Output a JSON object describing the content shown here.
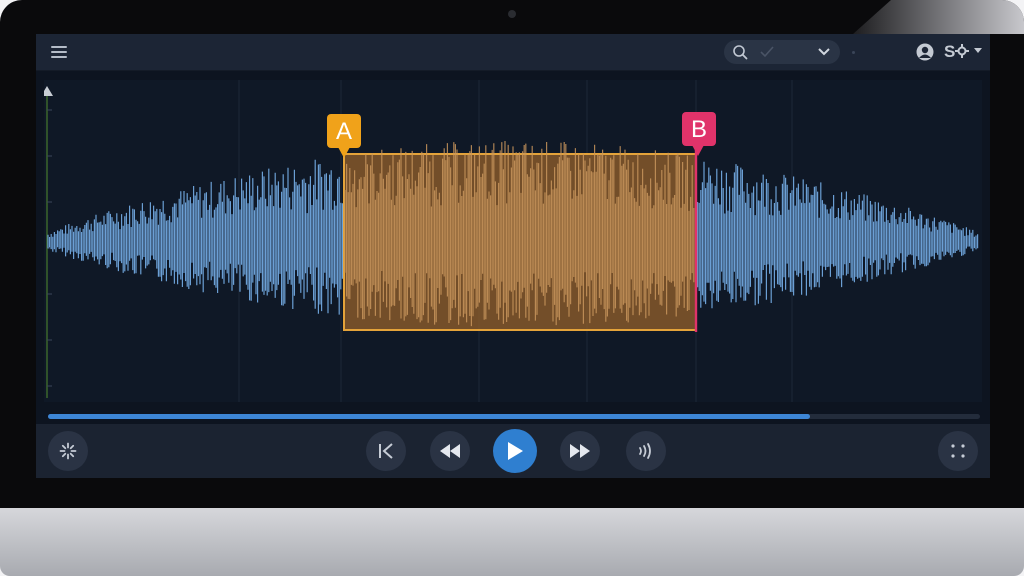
{
  "markers": {
    "a_label": "A",
    "b_label": "B"
  },
  "header": {
    "settings_label": "S"
  },
  "playback": {
    "progress": 0.818
  },
  "colors": {
    "wave": "#6b9fd4",
    "region_fill": "#8a5a2b",
    "region_wave": "#c8955c",
    "marker_a": "#f0a21a",
    "marker_b": "#e0336a",
    "accent": "#2f7fd0"
  },
  "icons": [
    "menu-icon",
    "search-icon",
    "check-icon",
    "chevron-down-icon",
    "user-icon",
    "settings-icon",
    "sparkle-icon",
    "skip-start-icon",
    "rewind-icon",
    "play-icon",
    "fast-forward-icon",
    "sound-waves-icon",
    "more-icon"
  ]
}
